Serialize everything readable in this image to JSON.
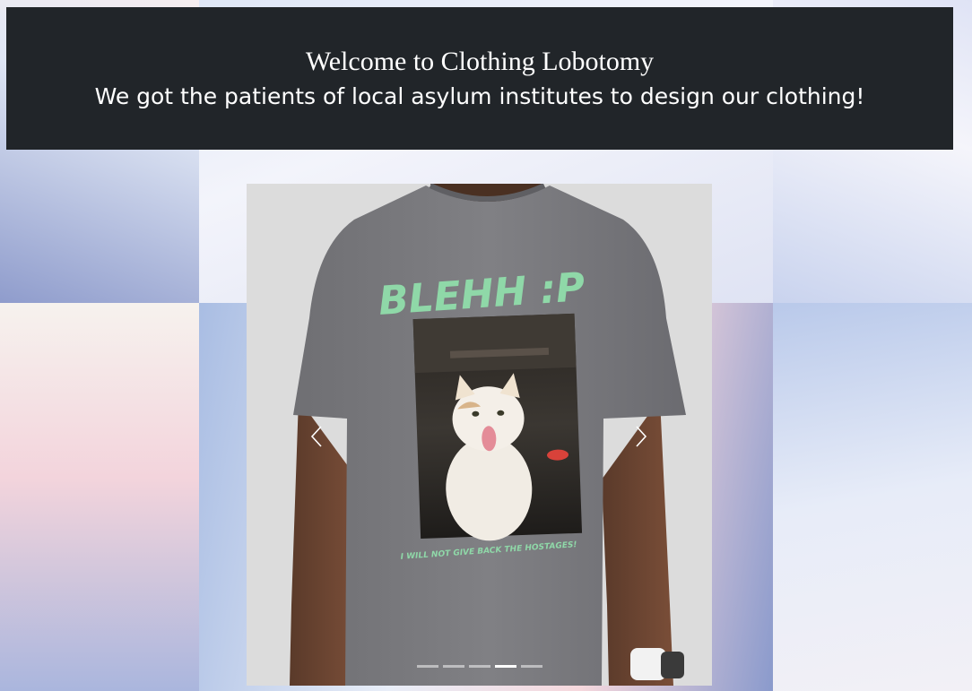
{
  "header": {
    "title": "Welcome to Clothing Lobotomy",
    "subtitle": "We got the patients of local asylum institutes to design our clothing!"
  },
  "carousel": {
    "shirt_text": "BLEHH :P",
    "shirt_tagline": "I WILL NOT GIVE BACK THE HOSTAGES!",
    "active_slide": 4,
    "slide_count": 5,
    "icons": {
      "prev": "chevron-left-icon",
      "next": "chevron-right-icon"
    },
    "colors": {
      "shirt": "#7c7c80",
      "print_text": "#8fd8a8"
    }
  }
}
